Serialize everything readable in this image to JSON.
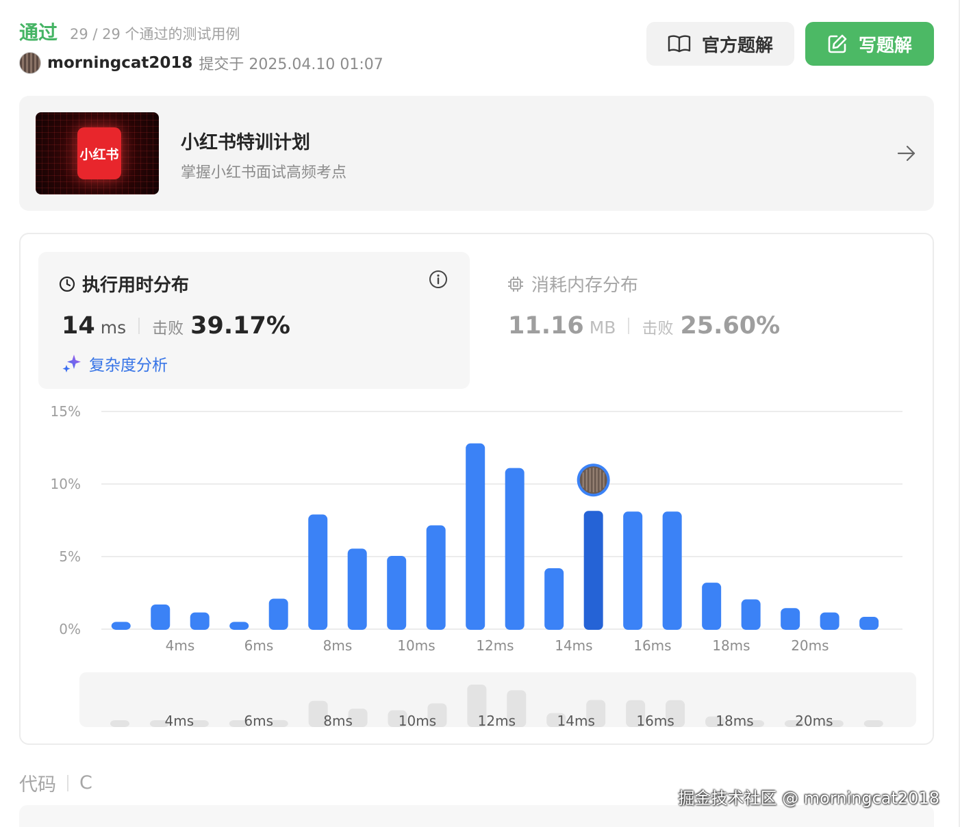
{
  "header": {
    "status": "通过",
    "testcases": "29 / 29 个通过的测试用例",
    "username": "morningcat2018",
    "submitted": "提交于 2025.04.10 01:07",
    "official_solution": "官方题解",
    "write_solution": "写题解"
  },
  "promo": {
    "logo_text": "小红书",
    "title": "小红书特训计划",
    "subtitle": "掌握小红书面试高频考点"
  },
  "runtime": {
    "title": "执行用时分布",
    "value": "14",
    "unit": "ms",
    "beat_label": "击败",
    "beat_pct": "39.17%",
    "complexity_link": "复杂度分析"
  },
  "memory": {
    "title": "消耗内存分布",
    "value": "11.16",
    "unit": "MB",
    "beat_label": "击败",
    "beat_pct": "25.60%"
  },
  "chart_data": {
    "type": "bar",
    "ytick_labels": [
      "0%",
      "5%",
      "10%",
      "15%"
    ],
    "ylim": [
      0,
      15
    ],
    "x_unit": "ms",
    "x_values": [
      2.5,
      3.5,
      4.5,
      5.5,
      6.5,
      7.5,
      8.5,
      9.5,
      10.5,
      11.5,
      12.5,
      13.5,
      14.5,
      15.5,
      16.5,
      17.5,
      18.5,
      19.5,
      20.5,
      21.5
    ],
    "xtick_labels": [
      "4ms",
      "6ms",
      "8ms",
      "10ms",
      "12ms",
      "14ms",
      "16ms",
      "18ms",
      "20ms"
    ],
    "values": [
      0.5,
      1.7,
      1.15,
      0.5,
      2.1,
      7.9,
      5.55,
      5.05,
      7.15,
      12.8,
      11.1,
      4.2,
      8.15,
      8.1,
      8.1,
      3.2,
      2.05,
      1.45,
      1.15,
      0.85
    ],
    "highlight_index": 12,
    "bar_color": "#3b82f6",
    "highlight_color": "#2563d6",
    "grid": true,
    "minimap_labels": [
      "4ms",
      "6ms",
      "8ms",
      "10ms",
      "12ms",
      "14ms",
      "16ms",
      "18ms",
      "20ms"
    ]
  },
  "footer": {
    "code_label": "代码",
    "language": "C",
    "watermark": "掘金技术社区 @ morningcat2018"
  },
  "colors": {
    "pass_green": "#45b464",
    "primary_blue": "#3b82f6",
    "link_blue": "#3573e6"
  },
  "icons": {
    "book": "book-open-icon",
    "edit": "edit-icon",
    "arrow": "arrow-right-icon",
    "clock": "clock-icon",
    "info": "info-icon",
    "sparkle": "sparkle-icon",
    "chip": "chip-icon"
  }
}
